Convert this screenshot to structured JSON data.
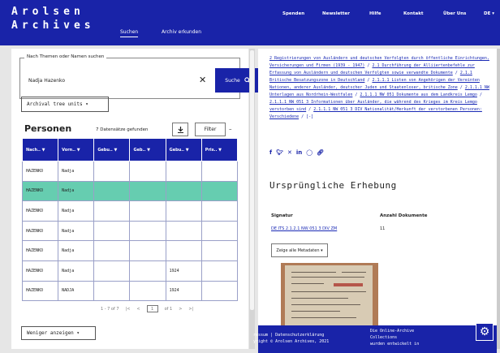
{
  "header": {
    "logo_line1": "Arolsen",
    "logo_line2": "Archives",
    "nav": [
      "Suchen",
      "Archiv erkunden"
    ],
    "top_links": [
      "Spenden",
      "Newsletter",
      "Hilfe",
      "Kontakt",
      "Über Uns",
      "DE ▾"
    ]
  },
  "search": {
    "legend": "Nach Themen oder Namen suchen",
    "value": "Nadja Hazenko",
    "button_label": "Suche",
    "tree_button": "Archival tree units ▾"
  },
  "persons": {
    "title": "Personen",
    "count_text": "7 Datensätze gefunden",
    "filter_label": "Filter",
    "columns": [
      "Nach..",
      "Vorn..",
      "Gebu..",
      "Geb..",
      "Gebu..",
      "Pris.."
    ],
    "rows": [
      [
        "HAZENKO",
        "Nadja",
        "",
        "",
        "",
        ""
      ],
      [
        "HAZENKO",
        "Nadja",
        "",
        "",
        "",
        ""
      ],
      [
        "HAZENKO",
        "Nadja",
        "",
        "",
        "",
        ""
      ],
      [
        "HAZENKO",
        "Nadja",
        "",
        "",
        "",
        ""
      ],
      [
        "HAZENKO",
        "Nadja",
        "",
        "",
        "",
        ""
      ],
      [
        "HAZENKO",
        "Nadja",
        "",
        "",
        "1924",
        ""
      ],
      [
        "HAZENKO",
        "NADJA",
        "",
        "",
        "1924",
        ""
      ]
    ],
    "highlighted_row": 1,
    "pager_range": "1 - 7 of 7",
    "pager_page": "1",
    "pager_of": "of 1",
    "less_button": "Weniger anzeigen ▾"
  },
  "detail": {
    "breadcrumb": [
      "2 Registrierungen von Ausländern und deutschen Verfolgten durch öffentliche Einrichtungen, Versicherungen und Firmen (1939 - 1947)",
      "2.1 Durchführung der Alliiertenbefehle zur Erfassung von Ausländern und deutschen Verfolgten sowie verwandte Dokumente",
      "2.1.1 Britische Besatzungszone in Deutschland",
      "2.1.1.1 Listen von Angehörigen der Vereinten Nationen, anderer Ausländer, deutscher Juden und Staatenloser, britische Zone",
      "2.1.1.1 NW Unterlagen aus Nordrhein-Westfalen",
      "2.1.1.1 NW 051 Dokumente aus dem Landkreis Lemgo",
      "2.1.1.1 NW 051 3 Informationen über Ausländer, die während des Krieges im Kreis Lemgo verstorben sind",
      "2.1.1.1 NW 051 3 DIV Nationalität/Herkunft der verstorbenen Personen: Verschiedene"
    ],
    "breadcrumb_toggle": "[-]",
    "share_icons": [
      "f",
      "y",
      "x",
      "in",
      "whatsapp",
      "link"
    ],
    "title": "Ursprüngliche Erhebung",
    "signature_label": "Signatur",
    "signature_value": "DE ITS 2.1.2.1 NW 051 3 DIV ZM",
    "docs_label": "Anzahl Dokumente",
    "docs_value": "11",
    "metadata_button": "Zeige alle Metadaten ▾"
  },
  "footer": {
    "left_line1": "ressum | Datenschutzerklärung",
    "left_line2": "yright © Arolsen Archives, 2021",
    "right_line1": "Die Online-Archive",
    "right_line2": "Collections",
    "right_line3": "wurden entwickelt in"
  },
  "colors": {
    "brand": "#1923a8",
    "highlight": "#66cdb0"
  }
}
